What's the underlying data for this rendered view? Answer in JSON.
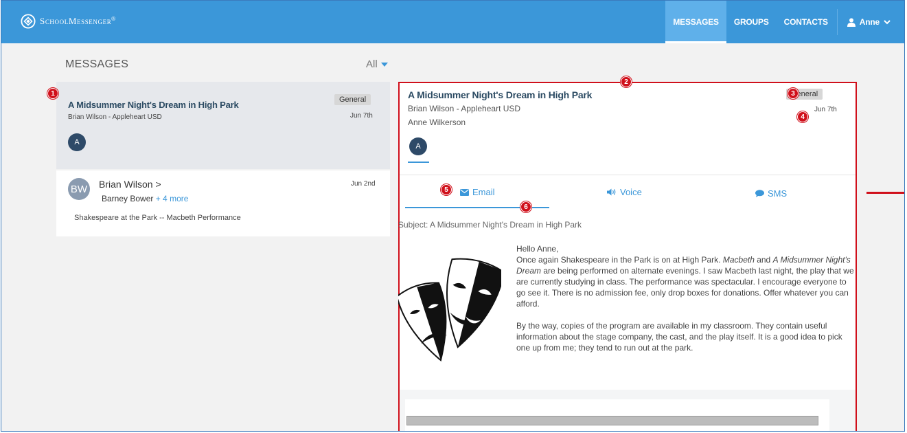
{
  "app": {
    "brand": "SchoolMessenger",
    "brand_mark": "®"
  },
  "nav": {
    "items": [
      "MESSAGES",
      "GROUPS",
      "CONTACTS"
    ],
    "user": "Anne"
  },
  "list": {
    "title": "MESSAGES",
    "filter": "All",
    "messages": [
      {
        "title": "A Midsummer Night's Dream in High Park",
        "sender": "Brian Wilson - Appleheart USD",
        "badge": "General",
        "date": "Jun 7th",
        "avatar": "A"
      },
      {
        "avatar": "BW",
        "name": "Brian Wilson >",
        "recipient": "Barney Bower",
        "more": "+ 4 more",
        "date": "Jun 2nd",
        "preview": "Shakespeare at the Park -- Macbeth Performance"
      }
    ]
  },
  "detail": {
    "title": "A Midsummer Night's Dream in High Park",
    "sender": "Brian Wilson - Appleheart USD",
    "recipient": "Anne Wilkerson",
    "badge": "General",
    "date": "Jun 7th",
    "avatar": "A",
    "tabs": {
      "email": "Email",
      "voice": "Voice",
      "sms": "SMS"
    },
    "subject": "Subject: A Midsummer Night's Dream in High Park",
    "body": {
      "greeting": "Hello Anne,",
      "p1_a": "Once again Shakespeare in the Park is on at High Park. ",
      "p1_em1": "Macbeth",
      "p1_b": " and ",
      "p1_em2": "A Midsummer Night's Dream",
      "p1_c": " are being performed on alternate evenings. I saw Macbeth last night, the play that we are currently studying in class. The performance was spectacular. I encourage everyone to go see it. There is no admission fee, only drop boxes for donations. Offer whatever you can afford.",
      "p2": "By the way, copies of the program are available in my classroom. They contain useful information about the stage company, the cast, and the play itself. It is a good idea to pick one up from me; they tend to run out at the park."
    }
  },
  "markers": [
    "1",
    "2",
    "3",
    "4",
    "5",
    "6"
  ],
  "colors": {
    "brand_blue": "#3b97d9",
    "annotation_red": "#d0101b",
    "title_navy": "#2c4b63"
  }
}
